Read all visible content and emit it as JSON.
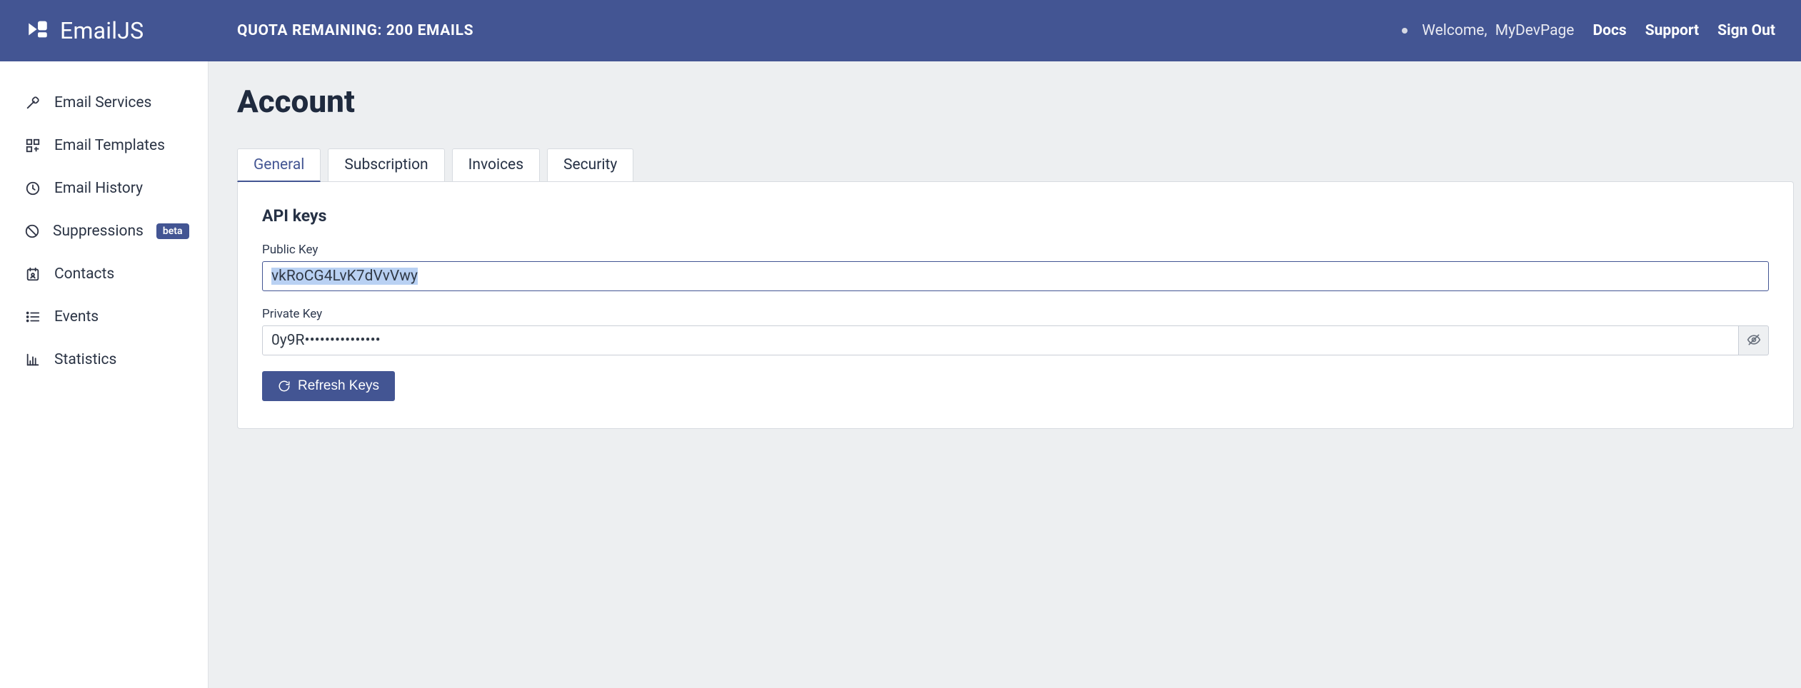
{
  "brand": {
    "name": "EmailJS"
  },
  "header": {
    "quota": "QUOTA REMAINING: 200 EMAILS",
    "welcome_prefix": "Welcome,",
    "username": "MyDevPage",
    "links": {
      "docs": "Docs",
      "support": "Support",
      "signout": "Sign Out"
    }
  },
  "sidebar": {
    "items": [
      {
        "label": "Email Services"
      },
      {
        "label": "Email Templates"
      },
      {
        "label": "Email History"
      },
      {
        "label": "Suppressions",
        "badge": "beta"
      },
      {
        "label": "Contacts"
      },
      {
        "label": "Events"
      },
      {
        "label": "Statistics"
      }
    ]
  },
  "page": {
    "title": "Account",
    "tabs": [
      {
        "label": "General",
        "active": true
      },
      {
        "label": "Subscription"
      },
      {
        "label": "Invoices"
      },
      {
        "label": "Security"
      }
    ]
  },
  "api_keys": {
    "section_title": "API keys",
    "public_key_label": "Public Key",
    "public_key_value": "vkRoCG4LvK7dVvVwy",
    "private_key_label": "Private Key",
    "private_key_value": "0y9R•••••••••••••••",
    "refresh_label": "Refresh Keys"
  }
}
